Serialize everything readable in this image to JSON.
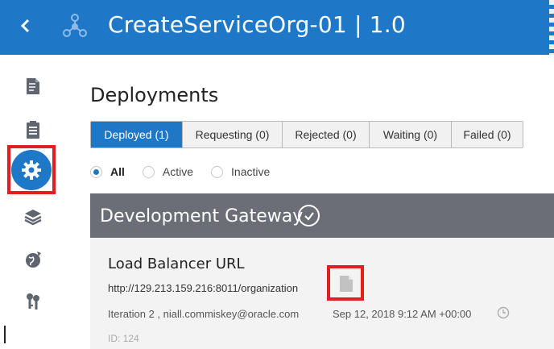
{
  "header": {
    "title": "CreateServiceOrg-01 | 1.0",
    "back_icon": "chevron-left-icon",
    "app_icon": "api-nodes-icon",
    "color": "#1e78c7"
  },
  "sidebar": {
    "items": [
      {
        "name": "api-implementation-icon",
        "active": false
      },
      {
        "name": "checklist-icon",
        "active": false
      },
      {
        "name": "deployments-gear-icon",
        "active": true
      },
      {
        "name": "layers-icon",
        "active": false
      },
      {
        "name": "globe-publication-icon",
        "active": false
      },
      {
        "name": "grants-keys-icon",
        "active": false
      }
    ]
  },
  "main": {
    "title": "Deployments",
    "tabs": [
      {
        "label": "Deployed (1)",
        "active": true
      },
      {
        "label": "Requesting (0)",
        "active": false
      },
      {
        "label": "Rejected (0)",
        "active": false
      },
      {
        "label": "Waiting (0)",
        "active": false
      },
      {
        "label": "Failed (0)",
        "active": false
      }
    ],
    "filters": [
      {
        "label": "All",
        "checked": true
      },
      {
        "label": "Active",
        "checked": false
      },
      {
        "label": "Inactive",
        "checked": false
      }
    ],
    "gateway": {
      "name": "Development Gateway",
      "label": "Load Balancer URL",
      "url": "http://129.213.159.216:8011/organization",
      "meta": "Iteration 2 , niall.commiskey@oracle.com",
      "date": "Sep 12, 2018 9:12 AM +00:00",
      "id": "ID: 124"
    }
  },
  "colors": {
    "accent": "#1e78c7",
    "gateway_bar": "#6b6e77",
    "highlight": "#e01f1f"
  }
}
